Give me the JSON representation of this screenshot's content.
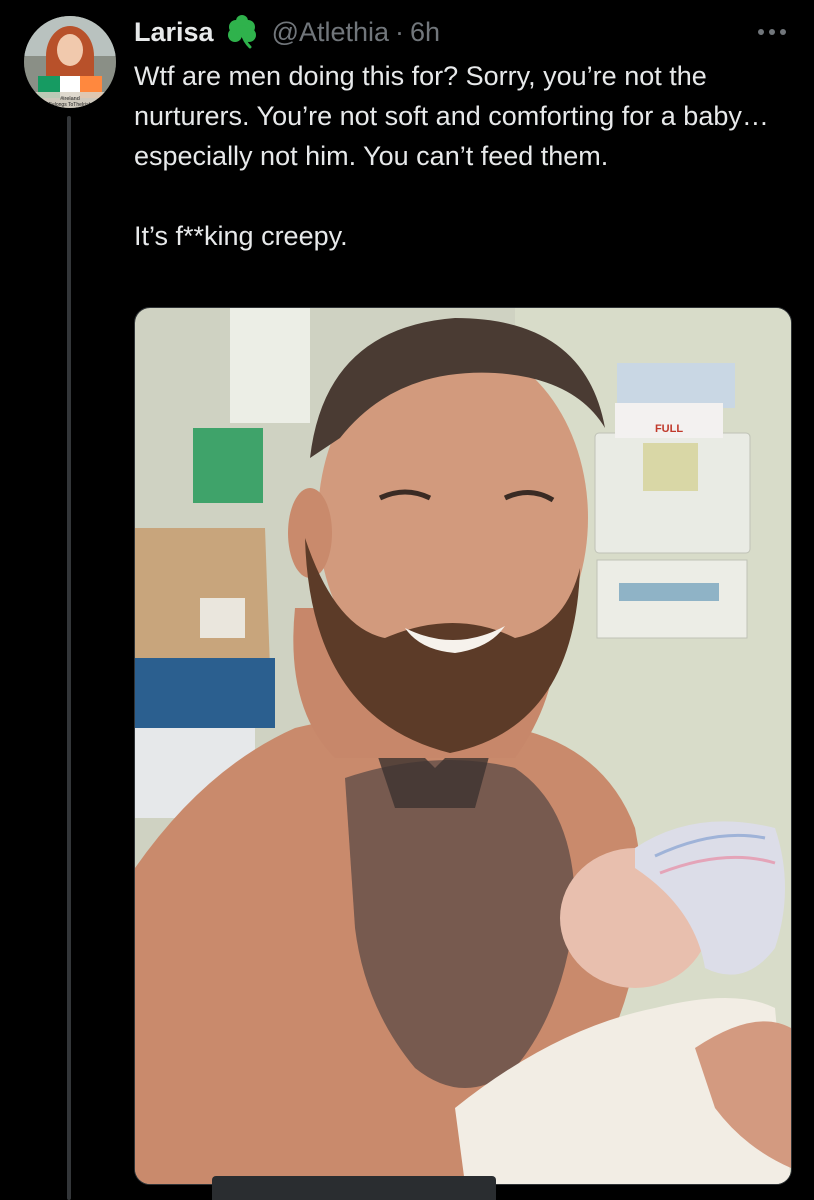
{
  "tweet": {
    "author": {
      "display_name": "Larisa",
      "badge_icon": "shamrock-icon",
      "handle": "@Atlethia",
      "avatar_caption": "#ireland Belongs ToTheIrish"
    },
    "separator": "·",
    "time": "6h",
    "more_icon": "more-horizontal-icon",
    "text": {
      "paragraph_1": "Wtf are men doing this for? Sorry, you’re not the nurturers. You’re not soft and comforting for a baby… especially not him. You can’t feed them.",
      "paragraph_2": "It’s f**king creepy."
    },
    "media": {
      "type": "photo",
      "sign_text": "FULL"
    }
  },
  "colors": {
    "background": "#000000",
    "text_primary": "#e7e9ea",
    "text_secondary": "#71767b",
    "badge_green": "#2fb24c",
    "thread_line": "#333639"
  }
}
